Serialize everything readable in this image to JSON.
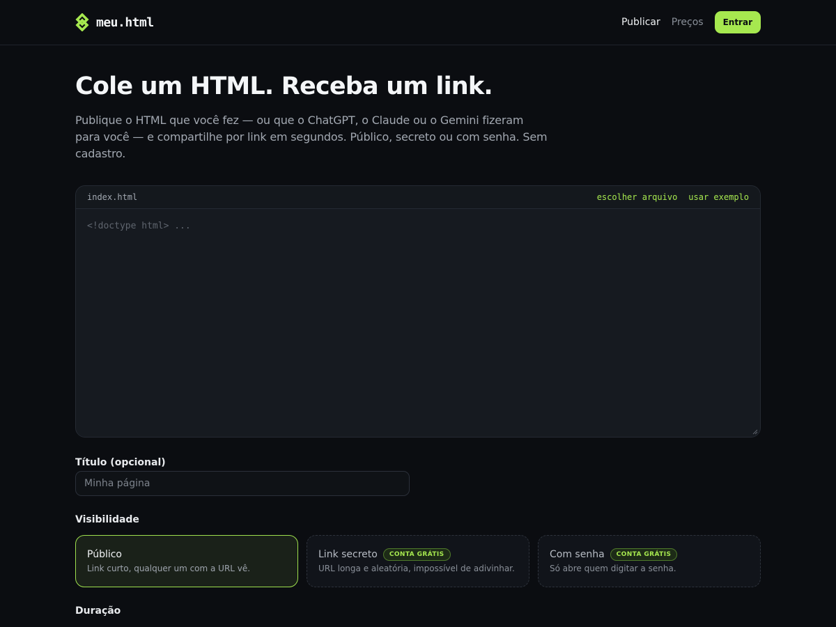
{
  "brand": {
    "name": "meu.html",
    "accent": "#a6e84f"
  },
  "nav": {
    "publish": "Publicar",
    "pricing": "Preços",
    "login": "Entrar"
  },
  "hero": {
    "title": "Cole um HTML. Receba um link.",
    "subtitle": "Publique o HTML que você fez — ou que o ChatGPT, o Claude ou o Gemini fizeram para você — e compartilhe por link em segundos. Público, secreto ou com senha. Sem cadastro."
  },
  "editor": {
    "file_name": "index.html",
    "choose_file": "escolher arquivo",
    "use_example": "usar exemplo",
    "value": "",
    "placeholder": "<!doctype html> ..."
  },
  "title_field": {
    "label": "Título (opcional)",
    "value": "",
    "placeholder": "Minha página"
  },
  "visibility": {
    "label": "Visibilidade",
    "selected": "public",
    "options": [
      {
        "id": "public",
        "title": "Público",
        "desc": "Link curto, qualquer um com a URL vê.",
        "badge": ""
      },
      {
        "id": "secret",
        "title": "Link secreto",
        "desc": "URL longa e aleatória, impossível de adivinhar.",
        "badge": "CONTA GRÁTIS"
      },
      {
        "id": "password",
        "title": "Com senha",
        "desc": "Só abre quem digitar a senha.",
        "badge": "CONTA GRÁTIS"
      }
    ]
  },
  "duration": {
    "label": "Duração"
  }
}
